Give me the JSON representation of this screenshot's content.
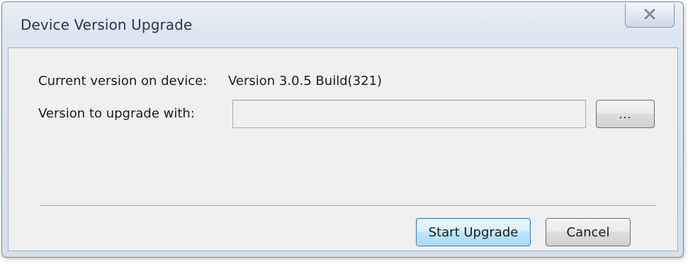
{
  "window": {
    "title": "Device Version Upgrade",
    "close_icon": "close-icon"
  },
  "form": {
    "current_version_label": "Current version on device:",
    "current_version_value": "Version 3.0.5 Build(321)",
    "upgrade_version_label": "Version to upgrade with:",
    "upgrade_file_value": "",
    "browse_label": "..."
  },
  "buttons": {
    "start_label": "Start Upgrade",
    "cancel_label": "Cancel"
  },
  "colors": {
    "default_button_border": "#3c7fb1",
    "title_text": "#2b3846"
  }
}
